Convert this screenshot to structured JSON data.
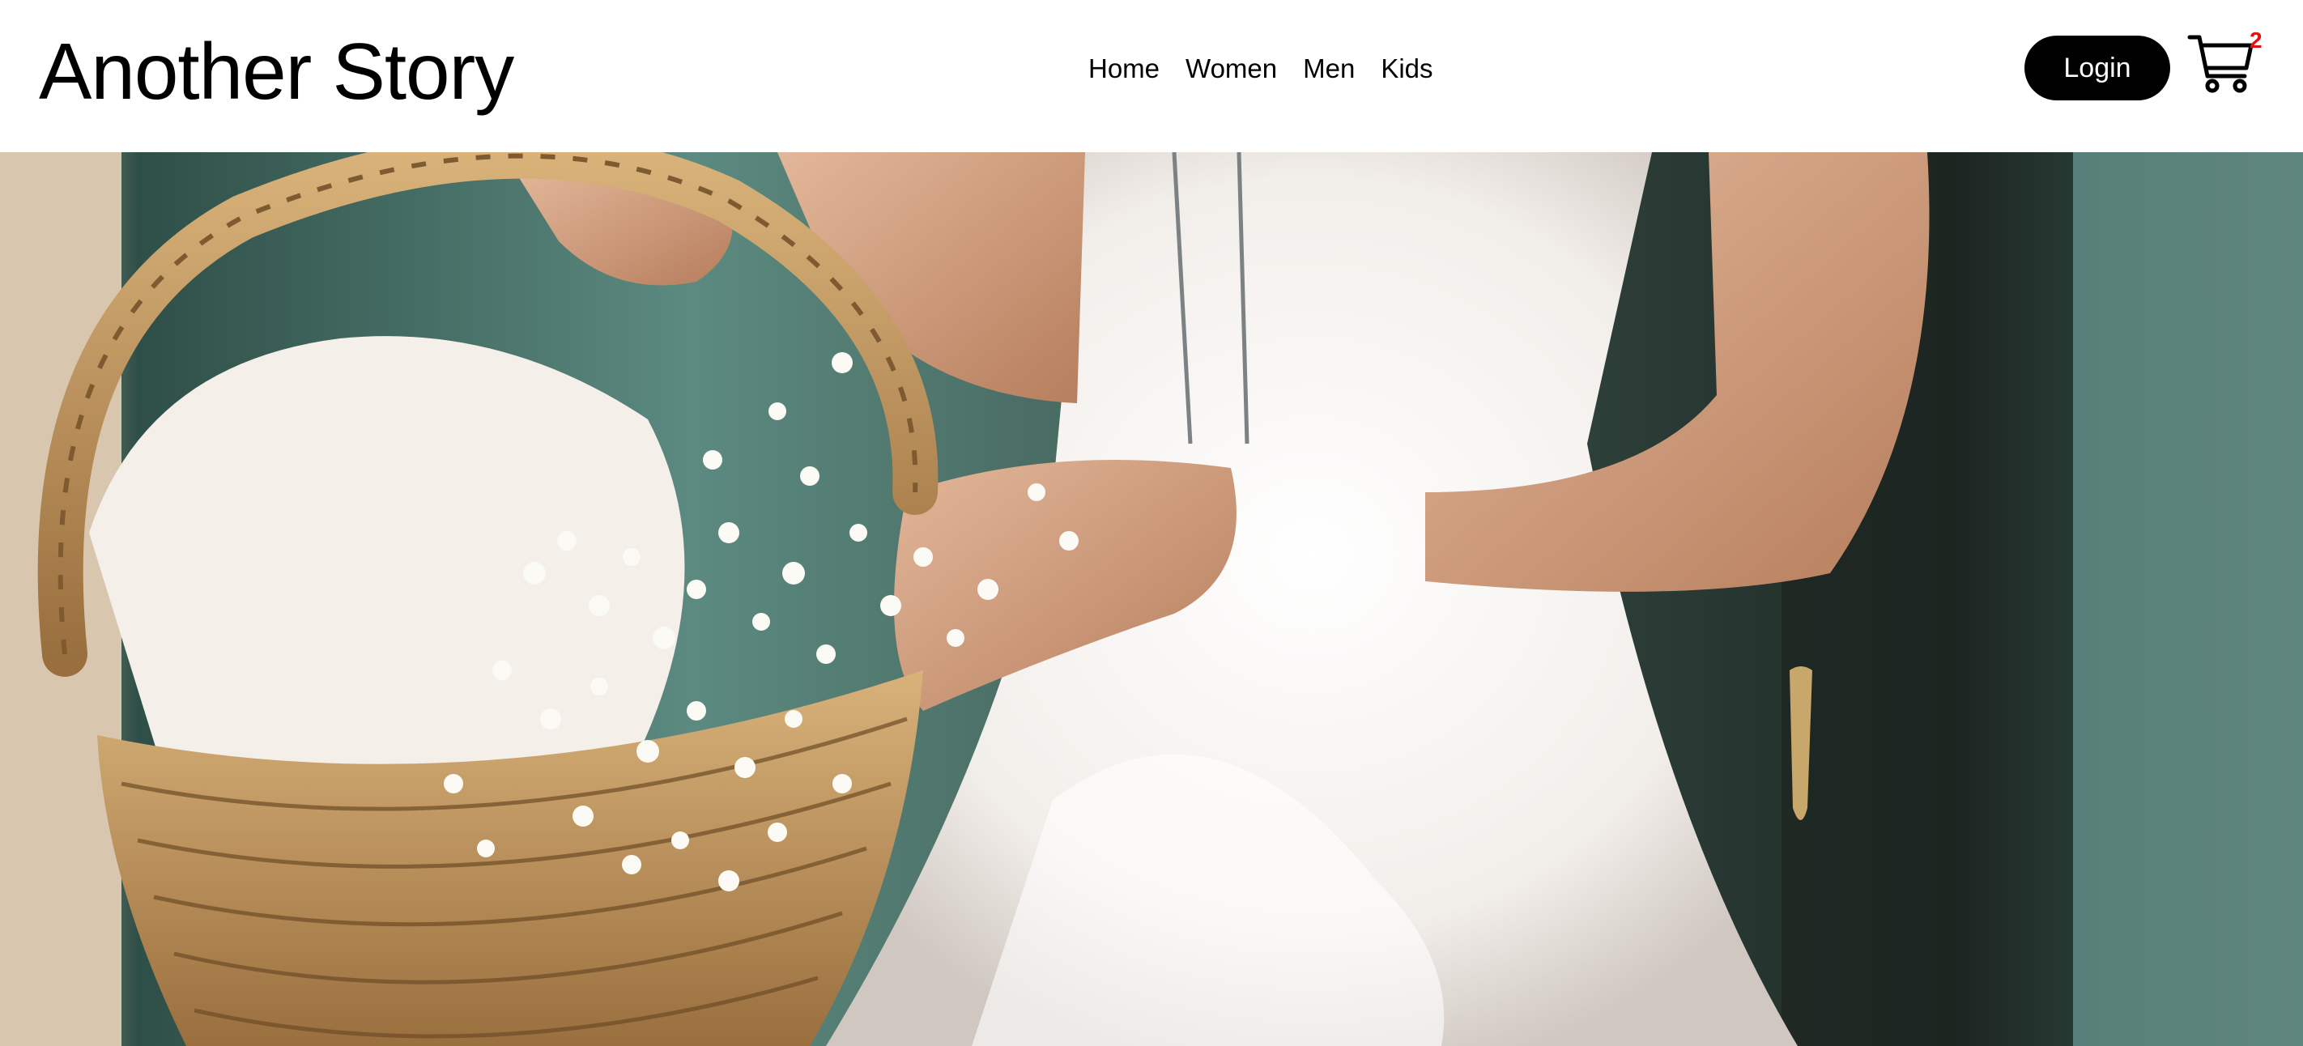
{
  "brand": {
    "title": "Another Story"
  },
  "nav": {
    "items": [
      {
        "label": "Home"
      },
      {
        "label": "Women"
      },
      {
        "label": "Men"
      },
      {
        "label": "Kids"
      }
    ]
  },
  "header_actions": {
    "login_label": "Login",
    "cart_count": "2",
    "cart_icon": "shopping-cart-icon"
  },
  "hero": {
    "image_subject": "hero-photo"
  },
  "colors": {
    "text": "#000000",
    "background": "#ffffff",
    "button": "#000000",
    "button_text": "#ffffff",
    "badge": "#e01010"
  }
}
